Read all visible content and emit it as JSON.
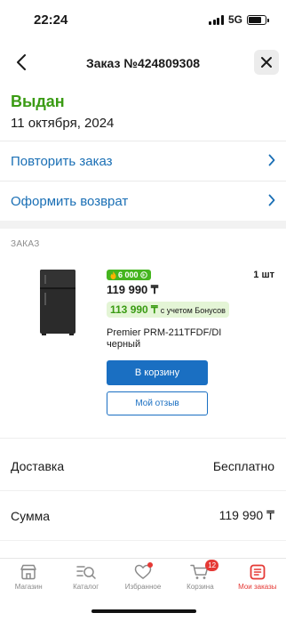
{
  "status_bar": {
    "time": "22:24",
    "network": "5G",
    "battery_level": 0.8
  },
  "nav": {
    "title": "Заказ №424809308",
    "back_icon": "chevron-left-icon",
    "close_icon": "close-icon"
  },
  "order": {
    "status": "Выдан",
    "status_color": "#3a9b13",
    "date": "11 октября, 2024"
  },
  "actions": {
    "repeat_label": "Повторить заказ",
    "return_label": "Оформить возврат",
    "link_color": "#1a6fb5"
  },
  "section_title": "ЗАКАЗ",
  "product": {
    "bonus_badge": "6 000",
    "bonus_icon": "flame-icon",
    "bonus_currency_icon": "bonus-coin-icon",
    "price": "119 990 ₸",
    "bonus_price": "113 990 ₸",
    "bonus_price_note": "с учетом Бонусов",
    "name": "Premier PRM-211TFDF/DI черный",
    "quantity": "1 шт",
    "cart_button": "В корзину",
    "review_button": "Мой отзыв"
  },
  "summary": {
    "delivery_label": "Доставка",
    "delivery_value": "Бесплатно",
    "total_label": "Сумма",
    "total_value": "119 990 ₸"
  },
  "tab_bar": {
    "accent_color": "#e53935",
    "cart_count": "12",
    "tabs": [
      {
        "label": "Магазин",
        "icon": "shop-icon"
      },
      {
        "label": "Каталог",
        "icon": "catalog-search-icon"
      },
      {
        "label": "Избранное",
        "icon": "heart-icon"
      },
      {
        "label": "Корзина",
        "icon": "cart-icon"
      },
      {
        "label": "Мои заказы",
        "icon": "orders-icon"
      }
    ]
  }
}
